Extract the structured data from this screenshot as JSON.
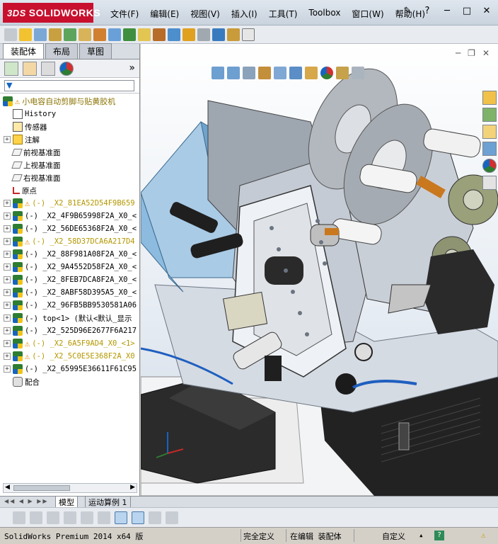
{
  "app": {
    "logo_text": "SOLIDWORKS",
    "logo_prefix": "3DS"
  },
  "menu": [
    "文件(F)",
    "编辑(E)",
    "视图(V)",
    "插入(I)",
    "工具(T)",
    "Toolbox",
    "窗口(W)",
    "帮助(H)"
  ],
  "panel_tabs": [
    "装配体",
    "布局",
    "草图"
  ],
  "tree": {
    "root": "小电容自动剪脚与贴黄胶机",
    "items": [
      {
        "label": "History",
        "icon": "history-icon",
        "expand": false
      },
      {
        "label": "传感器",
        "icon": "sensor-icon",
        "expand": false
      },
      {
        "label": "注解",
        "icon": "annotation-icon",
        "expand": true
      },
      {
        "label": "前视基准面",
        "icon": "plane-icon",
        "expand": false
      },
      {
        "label": "上视基准面",
        "icon": "plane-icon",
        "expand": false
      },
      {
        "label": "右视基准面",
        "icon": "plane-icon",
        "expand": false
      },
      {
        "label": "原点",
        "icon": "origin-icon",
        "expand": false
      },
      {
        "label": "(-) _X2_81EA52D54F9B659",
        "icon": "part-icon",
        "warn": true,
        "yellow": true,
        "expand": true
      },
      {
        "label": "(-) _X2_4F9B65998F2A_X0_<",
        "icon": "part-icon",
        "expand": true
      },
      {
        "label": "(-) _X2_56DE65368F2A_X0_<",
        "icon": "part-icon",
        "expand": true
      },
      {
        "label": "(-) _X2_58D37DCA6A217D4",
        "icon": "part-icon",
        "warn": true,
        "yellow": true,
        "expand": true
      },
      {
        "label": "(-) _X2_88F981A08F2A_X0_<",
        "icon": "part-icon",
        "expand": true
      },
      {
        "label": "(-) _X2_9A4552D58F2A_X0_<",
        "icon": "part-icon",
        "expand": true
      },
      {
        "label": "(-) _X2_8FEB7DCA8F2A_X0_<",
        "icon": "part-icon",
        "expand": true
      },
      {
        "label": "(-) _X2_8ABF58D395A5_X0_<",
        "icon": "part-icon",
        "expand": true
      },
      {
        "label": "(-) _X2_96FB5BB9530581A06",
        "icon": "part-icon",
        "expand": true
      },
      {
        "label": "(-) top<1> (默认<默认_显示",
        "icon": "part-icon",
        "expand": true
      },
      {
        "label": "(-) _X2_525D96E2677F6A217",
        "icon": "part-icon",
        "expand": true
      },
      {
        "label": "(-) _X2_6A5F9AD4_X0_<1>",
        "icon": "part-icon",
        "warn": true,
        "yellow": true,
        "expand": true
      },
      {
        "label": "(-) _X2_5C0E5E368F2A_X0",
        "icon": "part-icon",
        "warn": true,
        "yellow": true,
        "expand": true
      },
      {
        "label": "(-) _X2_65995E36611F61C95",
        "icon": "part-icon",
        "expand": true
      },
      {
        "label": "配合",
        "icon": "mate-icon",
        "expand": false
      }
    ]
  },
  "bottom_tabs": [
    "模型",
    "运动算例 1"
  ],
  "status": {
    "product": "SolidWorks Premium 2014 x64 版",
    "state": "完全定义",
    "editing": "在编辑 装配体",
    "units": "自定义"
  }
}
